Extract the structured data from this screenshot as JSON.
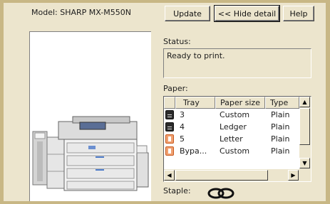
{
  "model": {
    "text": "Model:  SHARP  MX-M550N"
  },
  "buttons": {
    "update": "Update",
    "hide_detail": "<< Hide detail",
    "help": "Help"
  },
  "status": {
    "label": "Status:",
    "text": "Ready to print."
  },
  "paper": {
    "label": "Paper:",
    "columns": [
      "Tray",
      "Paper size",
      "Type"
    ],
    "rows": [
      {
        "tray": "3",
        "size": "Custom",
        "type": "Plain",
        "icon": "tray-dark-icon"
      },
      {
        "tray": "4",
        "size": "Ledger",
        "type": "Plain",
        "icon": "tray-dark-icon"
      },
      {
        "tray": "5",
        "size": "Letter",
        "type": "Plain",
        "icon": "tray-orange-icon"
      },
      {
        "tray": "Bypa...",
        "size": "Custom",
        "type": "Plain",
        "icon": "tray-orange-icon"
      }
    ]
  },
  "staple": {
    "label": "Staple:",
    "icon": "staple-icon"
  },
  "colors": {
    "background": "#ece5cd",
    "frame": "#c8b785"
  }
}
